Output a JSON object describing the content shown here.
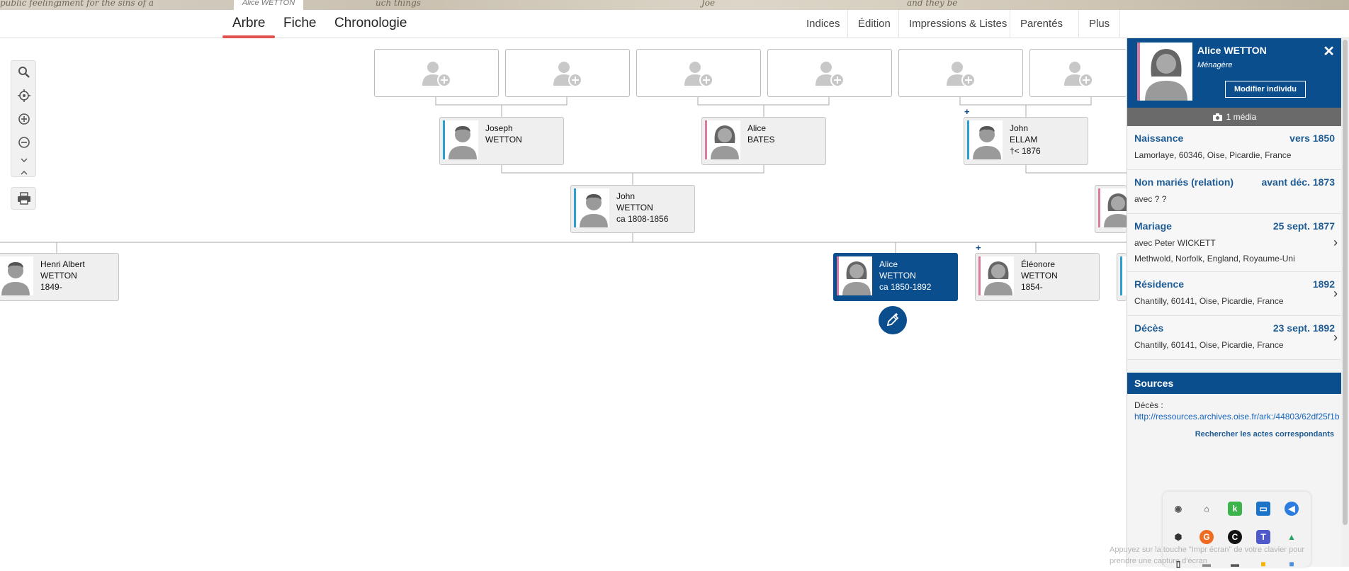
{
  "breadcrumb": "Alice WETTON",
  "banner_texts": [
    "public feeling:",
    "ament for the sins of a",
    "uch things",
    "Joe",
    "and they be"
  ],
  "tabs": [
    {
      "label": "Arbre",
      "active": true
    },
    {
      "label": "Fiche",
      "active": false
    },
    {
      "label": "Chronologie",
      "active": false
    }
  ],
  "right_menu": [
    "Indices",
    "Édition",
    "Impressions & Listes",
    "Parentés",
    "Plus"
  ],
  "tools": [
    "search-icon",
    "crosshair-icon",
    "zoom-in-icon",
    "zoom-out-icon",
    "collapse-icon",
    "print-icon"
  ],
  "tree": {
    "grandparents": {
      "name_line1": "Joseph",
      "name_line2": "WETTON",
      "dates": ""
    },
    "grandmother": {
      "name_line1": "Alice",
      "name_line2": "BATES",
      "dates": ""
    },
    "spouse_father": {
      "name_line1": "John",
      "name_line2": "ELLAM",
      "dates": "†< 1876"
    },
    "father": {
      "name_line1": "John",
      "name_line2": "WETTON",
      "dates": "ca 1808-1856"
    },
    "sibling1": {
      "name_line1": "Henri Albert",
      "name_line2": "WETTON",
      "dates": "1849-"
    },
    "selected": {
      "name_line1": "Alice",
      "name_line2": "WETTON",
      "dates": "ca 1850-1892"
    },
    "sibling2": {
      "name_line1": "Éléonore",
      "name_line2": "WETTON",
      "dates": "1854-"
    },
    "plus_marks": [
      "+",
      "+"
    ]
  },
  "panel": {
    "name": "Alice WETTON",
    "occupation": "Ménagère",
    "edit_button": "Modifier individu",
    "close": "✕",
    "media": "1 média",
    "events": [
      {
        "title": "Naissance",
        "date": "vers 1850",
        "line1": "Lamorlaye, 60346, Oise, Picardie, France",
        "line2": "",
        "chevron": false
      },
      {
        "title": "Non mariés (relation)",
        "date": "avant déc. 1873",
        "line1": "avec ? ?",
        "line2": "",
        "chevron": false
      },
      {
        "title": "Mariage",
        "date": "25 sept. 1877",
        "line1": "avec Peter WICKETT",
        "line2": "Methwold, Norfolk, England, Royaume-Uni",
        "chevron": true
      },
      {
        "title": "Résidence",
        "date": "1892",
        "line1": "Chantilly, 60141, Oise, Picardie, France",
        "line2": "",
        "chevron": true
      },
      {
        "title": "Décès",
        "date": "23 sept. 1892",
        "line1": "Chantilly, 60141, Oise, Picardie, France",
        "line2": "",
        "chevron": true
      }
    ],
    "sources_title": "Sources",
    "source_label": "Décès :",
    "source_url": "http://ressources.archives.oise.fr/ark:/44803/62df25f1b",
    "source_search": "Rechercher les actes correspondants"
  },
  "tray_hint": "Appuyez sur la touche \"Impr écran\" de votre clavier pour prendre une capture d'écran",
  "colors": {
    "accent": "#0a4e8e",
    "tab_underline": "#e0524f",
    "male": "#2a9fd0",
    "female": "#d97aa0"
  }
}
